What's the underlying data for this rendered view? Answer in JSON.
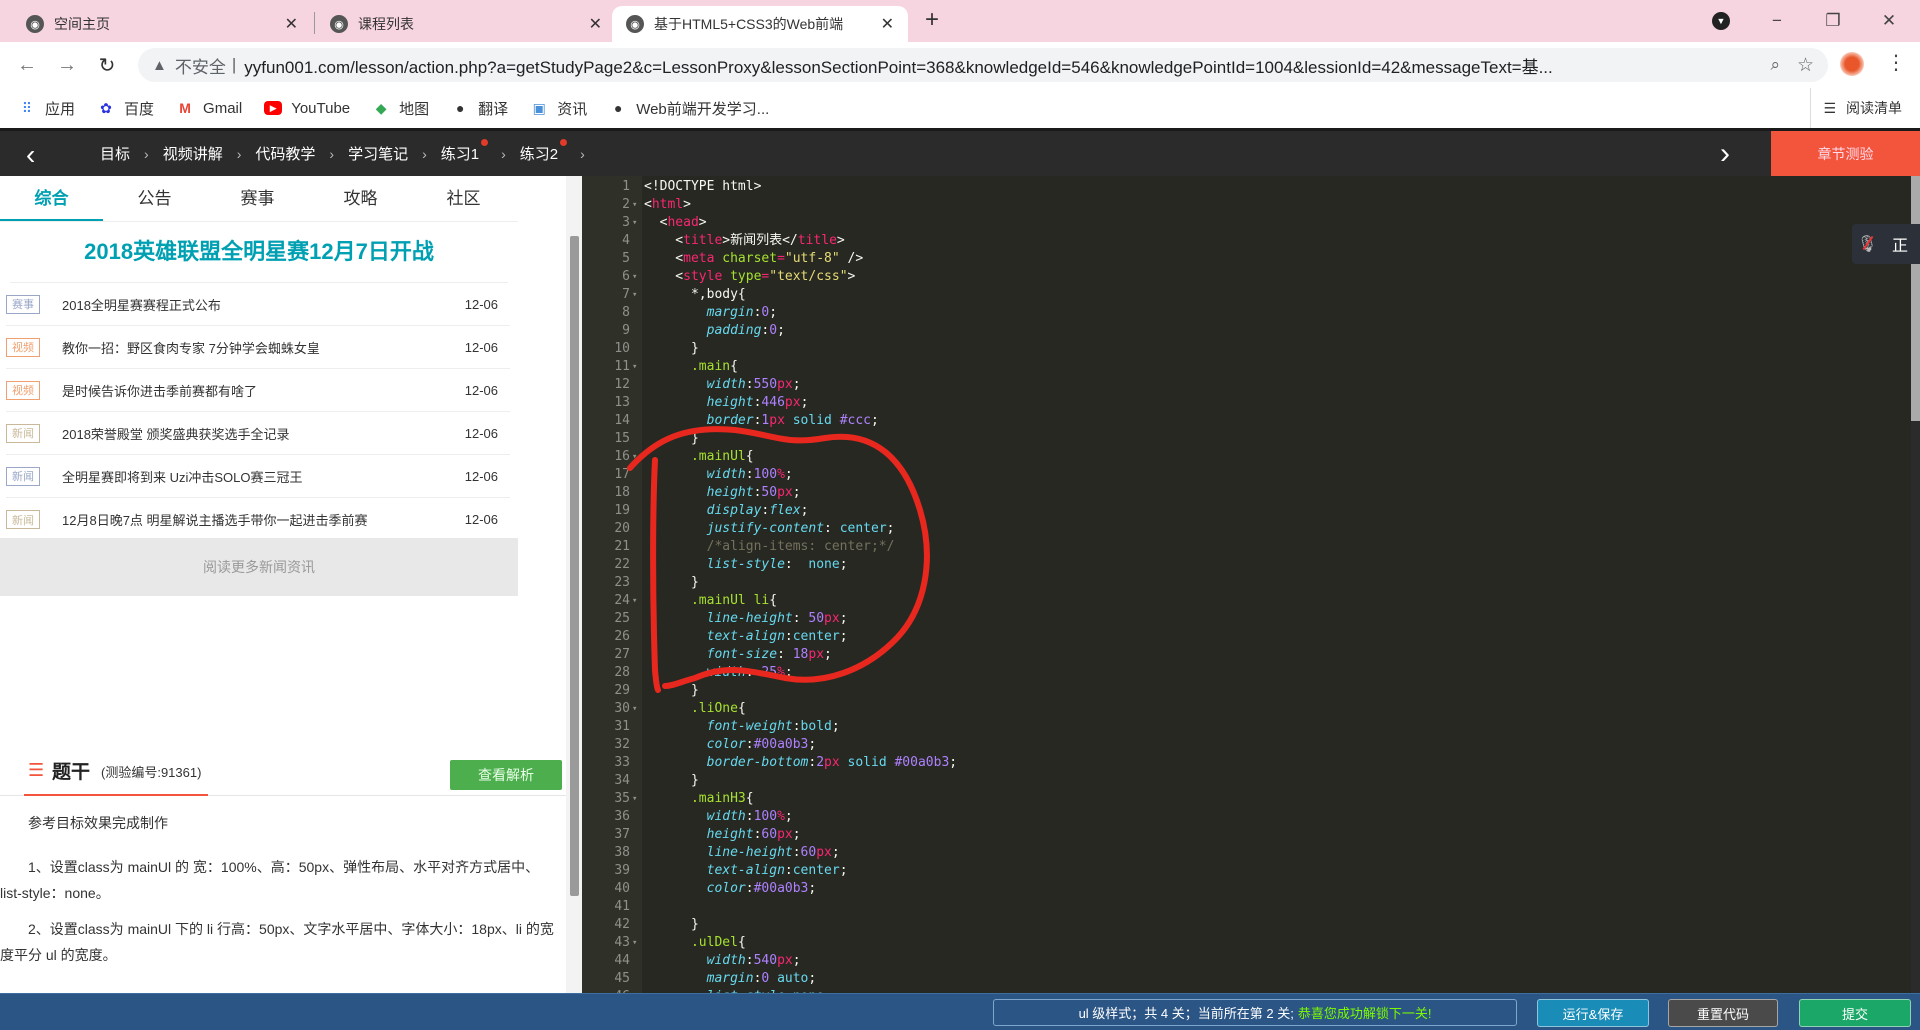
{
  "browser": {
    "tabs": [
      {
        "title": "空间主页",
        "active": false
      },
      {
        "title": "课程列表",
        "active": false
      },
      {
        "title": "基于HTML5+CSS3的Web前端",
        "active": true
      }
    ],
    "new_tab": "+",
    "window_controls": {
      "minimize": "−",
      "restore": "❐",
      "close": "✕"
    },
    "address": {
      "security_label": "不安全",
      "url": "yyfun001.com/lesson/action.php?a=getStudyPage2&c=LessonProxy&lessonSectionPoint=368&knowledgeId=546&knowledgePointId=1004&lessionId=42&messageText=基..."
    },
    "bookmarks": [
      {
        "label": "应用",
        "icon": "apps-grid-icon",
        "glyph": "⠿",
        "color": "#4285f4"
      },
      {
        "label": "百度",
        "icon": "baidu-paw-icon",
        "glyph": "🐾",
        "color": "#2932e1"
      },
      {
        "label": "Gmail",
        "icon": "gmail-icon",
        "glyph": "M",
        "color": "#ea4335"
      },
      {
        "label": "YouTube",
        "icon": "youtube-icon",
        "glyph": "▶",
        "color": "#ff0000"
      },
      {
        "label": "地图",
        "icon": "maps-icon",
        "glyph": "◆",
        "color": "#34a853"
      },
      {
        "label": "翻译",
        "icon": "globe-icon",
        "glyph": "●",
        "color": "#333333"
      },
      {
        "label": "资讯",
        "icon": "news-icon",
        "glyph": "▣",
        "color": "#4a90d9"
      },
      {
        "label": "Web前端开发学习...",
        "icon": "globe-icon",
        "glyph": "●",
        "color": "#333333"
      }
    ],
    "reading_list": "阅读清单"
  },
  "course_nav": {
    "crumbs": [
      {
        "label": "目标",
        "dot": false
      },
      {
        "label": "视频讲解",
        "dot": false
      },
      {
        "label": "代码教学",
        "dot": false
      },
      {
        "label": "学习笔记",
        "dot": false
      },
      {
        "label": "练习1",
        "dot": true
      },
      {
        "label": "练习2",
        "dot": true
      }
    ],
    "quiz_button": "章节测验",
    "accent": "#f3543c"
  },
  "preview": {
    "tabs": [
      "综合",
      "公告",
      "赛事",
      "攻略",
      "社区"
    ],
    "active_tab": 0,
    "headline": "2018英雄联盟全明星赛12月7日开战",
    "news": [
      {
        "tag": "赛事",
        "tag_color": "#9aa7c7",
        "title": "2018全明星赛赛程正式公布",
        "date": "12-06"
      },
      {
        "tag": "视频",
        "tag_color": "#f0a070",
        "title": "教你一招：野区食肉专家 7分钟学会蜘蛛女皇",
        "date": "12-06"
      },
      {
        "tag": "视频",
        "tag_color": "#f0a070",
        "title": "是时候告诉你进击季前赛都有啥了",
        "date": "12-06"
      },
      {
        "tag": "新闻",
        "tag_color": "#c9b99a",
        "title": "2018荣誉殿堂 颁奖盛典获奖选手全记录",
        "date": "12-06"
      },
      {
        "tag": "新闻",
        "tag_color": "#9aa7c7",
        "title": "全明星赛即将到来 Uzi冲击SOLO赛三冠王",
        "date": "12-06"
      },
      {
        "tag": "新闻",
        "tag_color": "#c9b99a",
        "title": "12月8日晚7点 明星解说主播选手带你一起进击季前赛",
        "date": "12-06"
      }
    ],
    "more_link": "阅读更多新闻资讯",
    "accent": "#00a0b3"
  },
  "question": {
    "title": "题干",
    "quiz_id": "(测验编号:91361)",
    "analysis_button": "查看解析",
    "intro": "参考目标效果完成制作",
    "items": [
      "1、设置class为 mainUl 的 宽：100%、高：50px、弹性布局、水平对齐方式居中、list-style：none。",
      "2、设置class为 mainUl 下的 li 行高：50px、文字水平居中、字体大小：18px、li 的宽度平分 ul 的宽度。"
    ]
  },
  "editor": {
    "lines": [
      [
        [
          "pl",
          "<!DOCTYPE html>"
        ]
      ],
      [
        [
          "pl",
          "<"
        ],
        [
          "tg",
          "html"
        ],
        [
          "pl",
          ">"
        ]
      ],
      [
        [
          "pl",
          "  <"
        ],
        [
          "tg",
          "head"
        ],
        [
          "pl",
          ">"
        ]
      ],
      [
        [
          "pl",
          "    <"
        ],
        [
          "tg",
          "title"
        ],
        [
          "pl",
          ">新闻列表</"
        ],
        [
          "tg",
          "title"
        ],
        [
          "pl",
          ">"
        ]
      ],
      [
        [
          "pl",
          "    <"
        ],
        [
          "tg",
          "meta"
        ],
        [
          "pl",
          " "
        ],
        [
          "at",
          "charset"
        ],
        [
          "tg",
          "="
        ],
        [
          "st",
          "\"utf-8\""
        ],
        [
          "pl",
          " />"
        ]
      ],
      [
        [
          "pl",
          "    <"
        ],
        [
          "tg",
          "style"
        ],
        [
          "pl",
          " "
        ],
        [
          "at",
          "type"
        ],
        [
          "tg",
          "="
        ],
        [
          "st",
          "\"text/css\""
        ],
        [
          "pl",
          ">"
        ]
      ],
      [
        [
          "pl",
          "      *,body{"
        ]
      ],
      [
        [
          "pl",
          "        "
        ],
        [
          "pr",
          "margin"
        ],
        [
          "pl",
          ":"
        ],
        [
          "nm",
          "0"
        ],
        [
          "pl",
          ";"
        ]
      ],
      [
        [
          "pl",
          "        "
        ],
        [
          "pr",
          "padding"
        ],
        [
          "pl",
          ":"
        ],
        [
          "nm",
          "0"
        ],
        [
          "pl",
          ";"
        ]
      ],
      [
        [
          "pl",
          "      }"
        ]
      ],
      [
        [
          "pl",
          "      "
        ],
        [
          "sel",
          ".main"
        ],
        [
          "pl",
          "{"
        ]
      ],
      [
        [
          "pl",
          "        "
        ],
        [
          "pr",
          "width"
        ],
        [
          "pl",
          ":"
        ],
        [
          "nm",
          "550"
        ],
        [
          "un",
          "px"
        ],
        [
          "pl",
          ";"
        ]
      ],
      [
        [
          "pl",
          "        "
        ],
        [
          "pr",
          "height"
        ],
        [
          "pl",
          ":"
        ],
        [
          "nm",
          "446"
        ],
        [
          "un",
          "px"
        ],
        [
          "pl",
          ";"
        ]
      ],
      [
        [
          "pl",
          "        "
        ],
        [
          "pr",
          "border"
        ],
        [
          "pl",
          ":"
        ],
        [
          "nm",
          "1"
        ],
        [
          "un",
          "px"
        ],
        [
          "pl",
          " "
        ],
        [
          "vl",
          "solid"
        ],
        [
          "pl",
          " "
        ],
        [
          "nm",
          "#ccc"
        ],
        [
          "pl",
          ";"
        ]
      ],
      [
        [
          "pl",
          "      }"
        ]
      ],
      [
        [
          "pl",
          "      "
        ],
        [
          "sel",
          ".mainUl"
        ],
        [
          "pl",
          "{"
        ]
      ],
      [
        [
          "pl",
          "        "
        ],
        [
          "pr",
          "width"
        ],
        [
          "pl",
          ":"
        ],
        [
          "nm",
          "100"
        ],
        [
          "un",
          "%"
        ],
        [
          "pl",
          ";"
        ]
      ],
      [
        [
          "pl",
          "        "
        ],
        [
          "pr",
          "height"
        ],
        [
          "pl",
          ":"
        ],
        [
          "nm",
          "50"
        ],
        [
          "un",
          "px"
        ],
        [
          "pl",
          ";"
        ]
      ],
      [
        [
          "pl",
          "        "
        ],
        [
          "pr",
          "display"
        ],
        [
          "pl",
          ":"
        ],
        [
          "pr",
          "flex"
        ],
        [
          "pl",
          ";"
        ]
      ],
      [
        [
          "pl",
          "        "
        ],
        [
          "pr",
          "justify-content"
        ],
        [
          "pl",
          ": "
        ],
        [
          "vl",
          "center"
        ],
        [
          "pl",
          ";"
        ]
      ],
      [
        [
          "pl",
          "        "
        ],
        [
          "cm",
          "/*align-items: center;*/"
        ]
      ],
      [
        [
          "pl",
          "        "
        ],
        [
          "pr",
          "list-style"
        ],
        [
          "pl",
          ":  "
        ],
        [
          "vl",
          "none"
        ],
        [
          "pl",
          ";"
        ]
      ],
      [
        [
          "pl",
          "      }"
        ]
      ],
      [
        [
          "pl",
          "      "
        ],
        [
          "sel",
          ".mainUl"
        ],
        [
          "pl",
          " "
        ],
        [
          "sel",
          "li"
        ],
        [
          "pl",
          "{"
        ]
      ],
      [
        [
          "pl",
          "        "
        ],
        [
          "pr",
          "line-height"
        ],
        [
          "pl",
          ": "
        ],
        [
          "nm",
          "50"
        ],
        [
          "un",
          "px"
        ],
        [
          "pl",
          ";"
        ]
      ],
      [
        [
          "pl",
          "        "
        ],
        [
          "pr",
          "text-align"
        ],
        [
          "pl",
          ":"
        ],
        [
          "vl",
          "center"
        ],
        [
          "pl",
          ";"
        ]
      ],
      [
        [
          "pl",
          "        "
        ],
        [
          "pr",
          "font-size"
        ],
        [
          "pl",
          ": "
        ],
        [
          "nm",
          "18"
        ],
        [
          "un",
          "px"
        ],
        [
          "pl",
          ";"
        ]
      ],
      [
        [
          "pl",
          "        "
        ],
        [
          "pr",
          "width"
        ],
        [
          "pl",
          ": "
        ],
        [
          "nm",
          "25"
        ],
        [
          "un",
          "%"
        ],
        [
          "pl",
          ";"
        ]
      ],
      [
        [
          "pl",
          "      }"
        ]
      ],
      [
        [
          "pl",
          "      "
        ],
        [
          "sel",
          ".liOne"
        ],
        [
          "pl",
          "{"
        ]
      ],
      [
        [
          "pl",
          "        "
        ],
        [
          "pr",
          "font-weight"
        ],
        [
          "pl",
          ":"
        ],
        [
          "vl",
          "bold"
        ],
        [
          "pl",
          ";"
        ]
      ],
      [
        [
          "pl",
          "        "
        ],
        [
          "pr",
          "color"
        ],
        [
          "pl",
          ":"
        ],
        [
          "nm",
          "#00a0b3"
        ],
        [
          "pl",
          ";"
        ]
      ],
      [
        [
          "pl",
          "        "
        ],
        [
          "pr",
          "border-bottom"
        ],
        [
          "pl",
          ":"
        ],
        [
          "nm",
          "2"
        ],
        [
          "un",
          "px"
        ],
        [
          "pl",
          " "
        ],
        [
          "vl",
          "solid"
        ],
        [
          "pl",
          " "
        ],
        [
          "nm",
          "#00a0b3"
        ],
        [
          "pl",
          ";"
        ]
      ],
      [
        [
          "pl",
          "      }"
        ]
      ],
      [
        [
          "pl",
          "      "
        ],
        [
          "sel",
          ".mainH3"
        ],
        [
          "pl",
          "{"
        ]
      ],
      [
        [
          "pl",
          "        "
        ],
        [
          "pr",
          "width"
        ],
        [
          "pl",
          ":"
        ],
        [
          "nm",
          "100"
        ],
        [
          "un",
          "%"
        ],
        [
          "pl",
          ";"
        ]
      ],
      [
        [
          "pl",
          "        "
        ],
        [
          "pr",
          "height"
        ],
        [
          "pl",
          ":"
        ],
        [
          "nm",
          "60"
        ],
        [
          "un",
          "px"
        ],
        [
          "pl",
          ";"
        ]
      ],
      [
        [
          "pl",
          "        "
        ],
        [
          "pr",
          "line-height"
        ],
        [
          "pl",
          ":"
        ],
        [
          "nm",
          "60"
        ],
        [
          "un",
          "px"
        ],
        [
          "pl",
          ";"
        ]
      ],
      [
        [
          "pl",
          "        "
        ],
        [
          "pr",
          "text-align"
        ],
        [
          "pl",
          ":"
        ],
        [
          "vl",
          "center"
        ],
        [
          "pl",
          ";"
        ]
      ],
      [
        [
          "pl",
          "        "
        ],
        [
          "pr",
          "color"
        ],
        [
          "pl",
          ":"
        ],
        [
          "nm",
          "#00a0b3"
        ],
        [
          "pl",
          ";"
        ]
      ],
      [
        [
          "pl",
          ""
        ]
      ],
      [
        [
          "pl",
          "      }"
        ]
      ],
      [
        [
          "pl",
          "      "
        ],
        [
          "sel",
          ".ulDel"
        ],
        [
          "pl",
          "{"
        ]
      ],
      [
        [
          "pl",
          "        "
        ],
        [
          "pr",
          "width"
        ],
        [
          "pl",
          ":"
        ],
        [
          "nm",
          "540"
        ],
        [
          "un",
          "px"
        ],
        [
          "pl",
          ";"
        ]
      ],
      [
        [
          "pl",
          "        "
        ],
        [
          "pr",
          "margin"
        ],
        [
          "pl",
          ":"
        ],
        [
          "nm",
          "0"
        ],
        [
          "pl",
          " "
        ],
        [
          "vl",
          "auto"
        ],
        [
          "pl",
          ";"
        ]
      ],
      [
        [
          "pl",
          "        "
        ],
        [
          "pr",
          "list-style"
        ],
        [
          "pl",
          ":"
        ],
        [
          "vl",
          "none"
        ],
        [
          "pl",
          ";"
        ]
      ]
    ],
    "fold_lines": [
      2,
      3,
      6,
      7,
      11,
      16,
      24,
      30,
      35,
      43
    ],
    "annotation_color": "#e8281e"
  },
  "floating_widget": {
    "mic_icon": "mic-muted-icon",
    "label": "正"
  },
  "bottom_bar": {
    "status_text": "ul 级样式；共 4 关；当前所在第 2 关;",
    "status_success": "恭喜您成功解锁下一关!",
    "run_save": "运行&保存",
    "reset_code": "重置代码",
    "submit": "提交"
  }
}
